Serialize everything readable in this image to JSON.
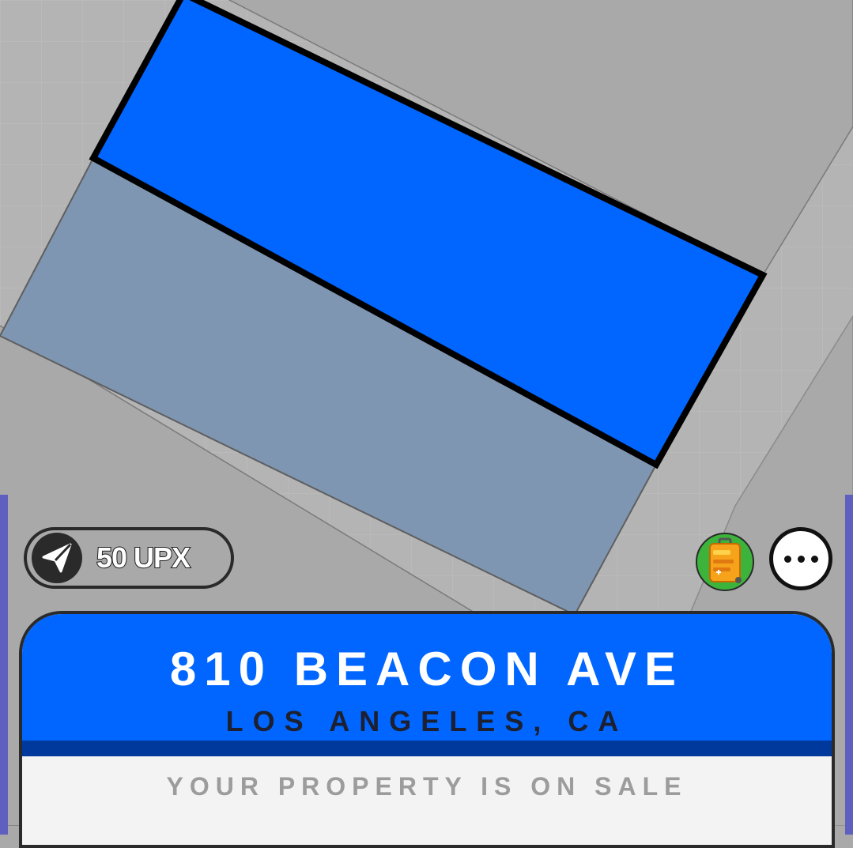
{
  "map": {
    "selected_parcel_color": "#0066ff",
    "owned_parcel_color": "#7f96b2",
    "background_color": "#a9a9a9"
  },
  "travel": {
    "icon": "paper-plane-icon",
    "cost_label": "50 UPX"
  },
  "actions": {
    "collection_icon": "suitcase-icon",
    "more_icon": "more-dots-icon"
  },
  "property": {
    "address": "810 BEACON AVE",
    "city": "LOS ANGELES, CA",
    "status": "YOUR PROPERTY IS ON SALE",
    "header_color": "#0066ff"
  }
}
